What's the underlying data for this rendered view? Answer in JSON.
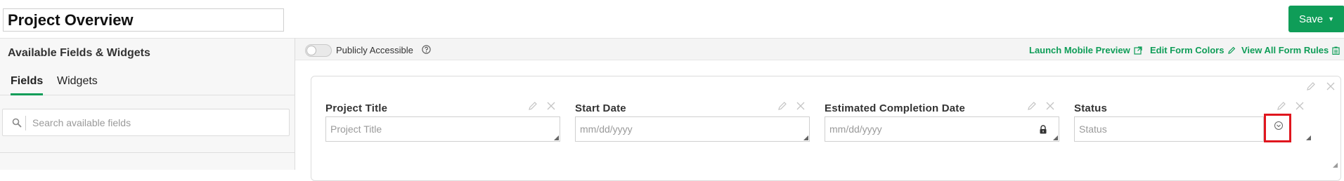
{
  "header": {
    "project_title": "Project Overview",
    "save_label": "Save"
  },
  "sidebar": {
    "title": "Available Fields & Widgets",
    "tabs": [
      {
        "label": "Fields",
        "active": true
      },
      {
        "label": "Widgets",
        "active": false
      }
    ],
    "search_placeholder": "Search available fields"
  },
  "toolbar": {
    "public_toggle_label": "Publicly Accessible",
    "public_toggle_on": false,
    "links": [
      {
        "label": "Launch Mobile Preview",
        "icon": "external-link-icon"
      },
      {
        "label": "Edit Form Colors",
        "icon": "pencil-icon"
      },
      {
        "label": "View All Form Rules",
        "icon": "clipboard-icon"
      }
    ]
  },
  "form": {
    "fields": [
      {
        "label": "Project Title",
        "placeholder": "Project Title",
        "type": "text"
      },
      {
        "label": "Start Date",
        "placeholder": "mm/dd/yyyy",
        "type": "date"
      },
      {
        "label": "Estimated Completion Date",
        "placeholder": "mm/dd/yyyy",
        "type": "date-locked"
      },
      {
        "label": "Status",
        "placeholder": "Status",
        "type": "select"
      }
    ]
  },
  "colors": {
    "brand_green": "#0f9d58",
    "highlight_red": "#e0161e"
  }
}
